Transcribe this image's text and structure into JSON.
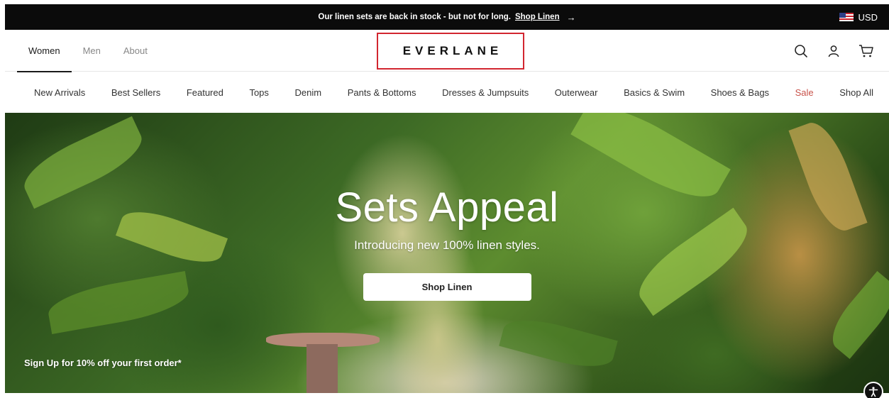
{
  "announcement": {
    "message": "Our linen sets are back in stock - but not for long.",
    "link_label": "Shop Linen",
    "arrow": "→"
  },
  "currency": {
    "flag_icon": "us-flag-icon",
    "label": "USD"
  },
  "header": {
    "tabs": [
      {
        "label": "Women",
        "active": true
      },
      {
        "label": "Men",
        "active": false
      },
      {
        "label": "About",
        "active": false
      }
    ],
    "logo": "EVERLANE",
    "logo_highlight_color": "#d22630",
    "icons": [
      "search-icon",
      "account-icon",
      "cart-icon"
    ]
  },
  "categories": [
    {
      "label": "New Arrivals"
    },
    {
      "label": "Best Sellers"
    },
    {
      "label": "Featured"
    },
    {
      "label": "Tops"
    },
    {
      "label": "Denim"
    },
    {
      "label": "Pants & Bottoms"
    },
    {
      "label": "Dresses & Jumpsuits"
    },
    {
      "label": "Outerwear"
    },
    {
      "label": "Basics & Swim"
    },
    {
      "label": "Shoes & Bags"
    },
    {
      "label": "Sale",
      "color": "#c8524a"
    },
    {
      "label": "Shop All"
    }
  ],
  "hero": {
    "title": "Sets Appeal",
    "subtitle": "Introducing new 100% linen styles.",
    "cta_label": "Shop Linen",
    "signup_text": "Sign Up for 10% off your first order*"
  },
  "accessibility": {
    "icon": "accessibility-icon"
  }
}
